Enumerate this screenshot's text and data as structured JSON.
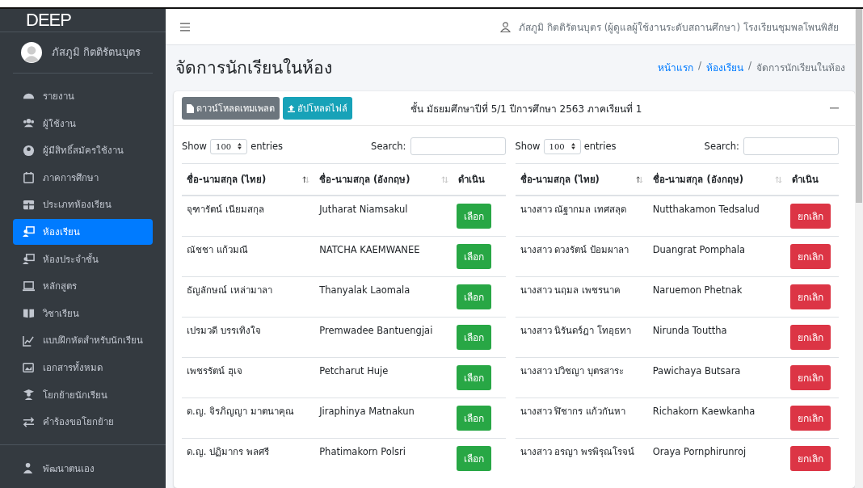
{
  "sidebar": {
    "logo": "DEEP",
    "user": "ภัสภูมิ กิตติรัตนบุตร",
    "items": [
      {
        "label": "รายงาน",
        "selected": false
      },
      {
        "label": "ผู้ใช้งาน",
        "selected": false
      },
      {
        "label": "ผู้มีสิทธิ์สมัครใช้งาน",
        "selected": false
      },
      {
        "label": "ภาคการศึกษา",
        "selected": false
      },
      {
        "label": "ประเภทห้องเรียน",
        "selected": false
      },
      {
        "label": "ห้องเรียน",
        "selected": true
      },
      {
        "label": "ห้องประจำชั้น",
        "selected": false
      },
      {
        "label": "หลักสูตร",
        "selected": false
      },
      {
        "label": "วิชาเรียน",
        "selected": false
      },
      {
        "label": "แบบฝึกหัดสำหรับนักเรียน",
        "selected": false
      },
      {
        "label": "เอกสารทั้งหมด",
        "selected": false
      },
      {
        "label": "โยกย้ายนักเรียน",
        "selected": false
      },
      {
        "label": "คำร้องขอโยกย้าย",
        "selected": false
      }
    ],
    "bottom_items": [
      {
        "label": "พัฒนาตนเอง",
        "selected": false
      }
    ]
  },
  "topbar": {
    "user_info": "ภัสภูมิ กิตติรัตนบุตร (ผู้ดูแลผู้ใช้งานระดับสถานศึกษา) โรงเรียนชุมพลโพนพิสัย"
  },
  "page_title": "จัดการนักเรียนในห้อง",
  "breadcrumb_separator": "/",
  "breadcrumb": [
    {
      "label": "หน้าแรก",
      "link": true
    },
    {
      "label": "ห้องเรียน",
      "link": true
    },
    {
      "label": "จัดการนักเรียนในห้อง",
      "link": false
    }
  ],
  "card": {
    "buttons": [
      {
        "label": "ดาวน์โหลดเทมเพลต",
        "kind": "download"
      },
      {
        "label": "อัปโหลดไฟล์",
        "kind": "upload"
      }
    ],
    "title": "ชั้น มัธยมศึกษาปีที่ 5/1 ปีการศึกษา 2563 ภาคเรียนที่ 1",
    "tables": [
      {
        "kind": "select",
        "show": "Show",
        "page_size": "100",
        "entries": "entries",
        "search": "Search:",
        "columns": [
          "ชื่อ-นามสกุล (ไทย)",
          "ชื่อ-นามสกุล (อังกฤษ)",
          "ดำเนิน"
        ],
        "rows": [
          {
            "thai": "จุฑารัตน์ เนียมสกุล",
            "english": "Jutharat Niamsakul",
            "action": "เลือก"
          },
          {
            "thai": "ณัชชา แก้วมณี",
            "english": "NATCHA KAEMWANEE",
            "action": "เลือก"
          },
          {
            "thai": "ธัญลักษณ์ เหล่ามาลา",
            "english": "Thanyalak Laomala",
            "action": "เลือก"
          },
          {
            "thai": "เปรมวดี บรรเทิงใจ",
            "english": "Premwadee Bantuengjai",
            "action": "เลือก"
          },
          {
            "thai": "เพชรรัตน์ ฮุเจ",
            "english": "Petcharut Huje",
            "action": "เลือก"
          },
          {
            "thai": "ด.ญ. จิรภิญญา มาตนาคุณ",
            "english": "Jiraphinya Matnakun",
            "action": "เลือก"
          },
          {
            "thai": "ด.ญ. ปฏิมากร พลศรี",
            "english": "Phatimakorn Polsri",
            "action": "เลือก"
          }
        ]
      },
      {
        "kind": "cancel",
        "show": "Show",
        "page_size": "100",
        "entries": "entries",
        "search": "Search:",
        "columns": [
          "ชื่อ-นามสกุล (ไทย)",
          "ชื่อ-นามสกุล (อังกฤษ)",
          "ดำเนิน"
        ],
        "rows": [
          {
            "thai": "นางสาว ณัฐากมล เทศสลุด",
            "english": "Nutthakamon Tedsalud",
            "action": "ยกเลิก"
          },
          {
            "thai": "นางสาว ดวงรัตน์ ป้อมผาลา",
            "english": "Duangrat Pomphala",
            "action": "ยกเลิก"
          },
          {
            "thai": "นางสาว นฤมล เพชรนาค",
            "english": "Naruemon Phetnak",
            "action": "ยกเลิก"
          },
          {
            "thai": "นางสาว นิรันดร์ฎา โทอุธทา",
            "english": "Nirunda Touttha",
            "action": "ยกเลิก"
          },
          {
            "thai": "นางสาว ปวิชญา บุตรสาระ",
            "english": "Pawichaya Butsara",
            "action": "ยกเลิก"
          },
          {
            "thai": "นางสาว ฬิชากร แก้วกันหา",
            "english": "Richakorn Kaewkanha",
            "action": "ยกเลิก"
          },
          {
            "thai": "นางสาว อรญา พรพิรุณโรจน์",
            "english": "Oraya Pornphirunroj",
            "action": "ยกเลิก"
          }
        ]
      }
    ]
  }
}
